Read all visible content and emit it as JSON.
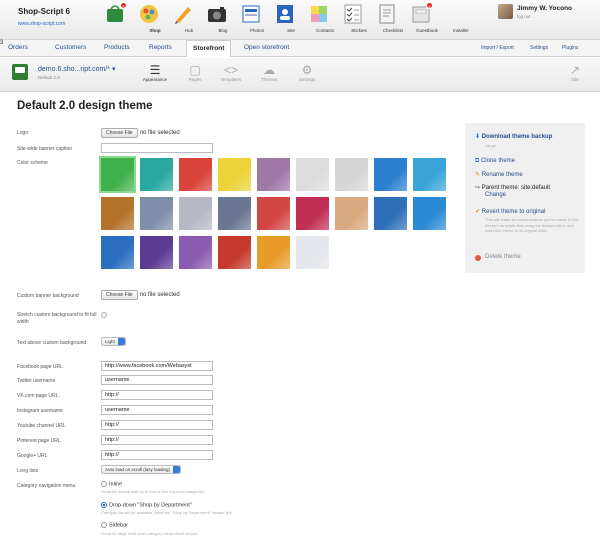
{
  "brand": {
    "name": "Shop-Script 6",
    "site": "www.shop-script.com"
  },
  "apps": [
    {
      "label": "Shop",
      "icon": "shop-icon",
      "badge": "8",
      "active": true
    },
    {
      "label": "Hub",
      "icon": "hub-icon"
    },
    {
      "label": "Blog",
      "icon": "blog-icon"
    },
    {
      "label": "Photos",
      "icon": "photos-icon"
    },
    {
      "label": "Site",
      "icon": "site-icon"
    },
    {
      "label": "Contacts",
      "icon": "contacts-icon"
    },
    {
      "label": "Stickies",
      "icon": "stickies-icon"
    },
    {
      "label": "Checklists",
      "icon": "checklists-icon"
    },
    {
      "label": "Guestbook",
      "icon": "guestbook-icon"
    },
    {
      "label": "Installer",
      "icon": "installer-icon",
      "badge": "4"
    }
  ],
  "user": {
    "name": "Jimmy W. Yocono",
    "logout": "log out"
  },
  "nav": {
    "orders": "Orders",
    "orders_badge": "3",
    "customers": "Customers",
    "products": "Products",
    "reports": "Reports",
    "storefront": "Storefront",
    "open_storefront": "Open storefront",
    "import_export": "Import / Export",
    "settings": "Settings",
    "plugins": "Plugins"
  },
  "storefront": {
    "domain": "demo.6.sho...ript.com/*",
    "theme_name": "Default 2.0",
    "tabs": [
      {
        "label": "Appearance",
        "icon": "appearance-icon"
      },
      {
        "label": "Pages",
        "icon": "pages-icon"
      },
      {
        "label": "Templates",
        "icon": "templates-icon"
      },
      {
        "label": "Themes",
        "icon": "themes-icon"
      },
      {
        "label": "Settings",
        "icon": "settings-icon"
      }
    ],
    "site_label": "Site"
  },
  "main": {
    "title": "Default 2.0 design theme",
    "fields": {
      "logo": "Logo",
      "banner_caption": "Site-wide banner caption",
      "color_scheme": "Color scheme",
      "custom_banner_bg": "Custom banner background",
      "stretch_bg": "Stretch custom background to fit full width",
      "text_above_bg": "Text above custom background",
      "facebook": "Facebook page URL",
      "twitter": "Twitter username",
      "vk": "VK.com page URL",
      "instagram": "Instagram username",
      "youtube": "Youtube channel URL",
      "pinterest": "Pinterest page URL",
      "googleplus": "Google+ URL",
      "long_lists": "Long lists",
      "category_nav": "Category navigation menu"
    },
    "choose_file": "Choose File",
    "no_file": "no file selected",
    "text_color_value": "Light",
    "values": {
      "facebook": "http://www.facebook.com/Webasyst",
      "twitter": "username",
      "vk": "http://",
      "instagram": "username",
      "youtube": "http://",
      "pinterest": "http://",
      "googleplus": "http://"
    },
    "long_lists_value": "Auto load on scroll (lazy loading)",
    "nav_options": [
      {
        "label": "Inline",
        "desc": "Great for menus with up to four or five top-level categories."
      },
      {
        "label": "Drop-down \"Shop by Department\"",
        "desc": "Category list will be available under the \"Shop by Department\" header link."
      },
      {
        "label": "Sidebar",
        "desc": "Great for large multi-level category hierarchical menus."
      }
    ]
  },
  "color_schemes": [
    [
      "#3fb04a",
      "#2aa79f",
      "#d9433a",
      "#ecd33a",
      "#9f78a8",
      "#dcdcdc",
      "#d6d6d6",
      "#2c7fd0",
      "#3aa4d8"
    ],
    [
      "#b5722b",
      "#7f8ea9",
      "#b7b9c4",
      "#6b7692",
      "#d24744",
      "#c12e56",
      "#d8a87f",
      "#2e6fb7",
      "#2b8ad4"
    ],
    [
      "#2c6fbf",
      "#5b3b94",
      "#8a5bb0",
      "#c53a2d",
      "#e99b2a",
      "#e4e7eb"
    ]
  ],
  "sidebar": {
    "download": "Download theme backup",
    "download_note": ".tar.gz",
    "clone": "Clone theme",
    "rename": "Rename theme",
    "parent_label": "Parent theme: site:default",
    "change": "Change",
    "revert": "Revert theme to original",
    "revert_note": "This will erase all customizations you've made to this theme's template files using the design editor, and reset this theme to its original state.",
    "delete": "Delete theme"
  }
}
